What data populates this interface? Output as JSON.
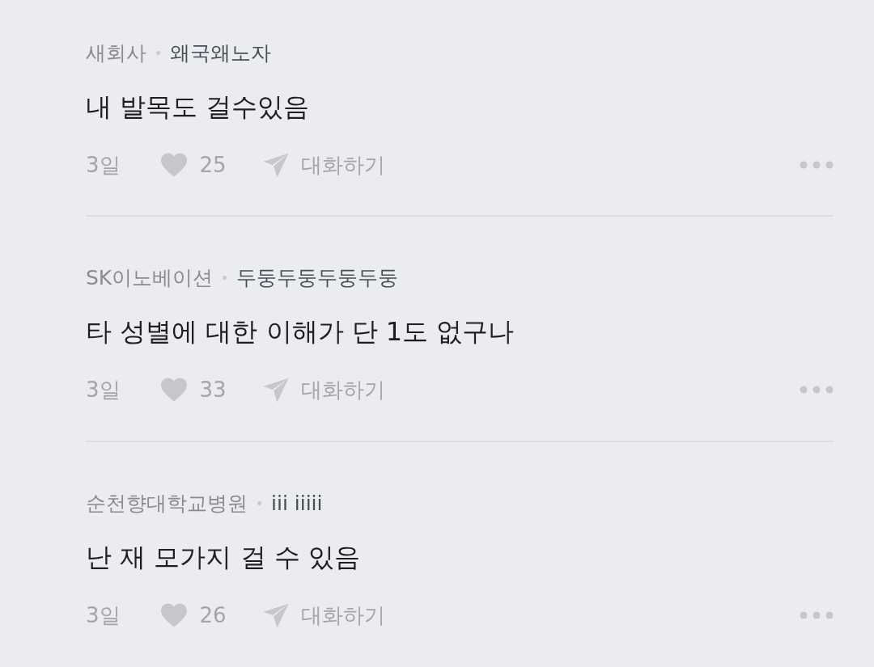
{
  "comments": [
    {
      "company": "새회사",
      "author": "왜국왜노자",
      "text": "내 발목도 걸수있음",
      "time": "3일",
      "likes": "25",
      "reply": "대화하기"
    },
    {
      "company": "SK이노베이션",
      "author": "두둥두둥두둥두둥",
      "text": "타 성별에 대한 이해가 단 1도 없구나",
      "time": "3일",
      "likes": "33",
      "reply": "대화하기"
    },
    {
      "company": "순천향대학교병원",
      "author": "iii iiiii",
      "text": "난 재 모가지 걸 수 있음",
      "time": "3일",
      "likes": "26",
      "reply": "대화하기"
    }
  ]
}
